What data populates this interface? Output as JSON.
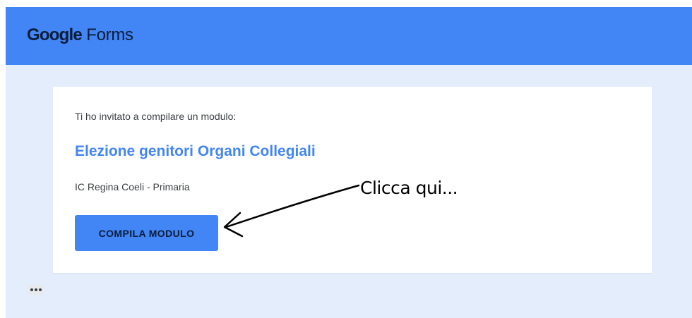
{
  "header": {
    "logo_brand": "Google",
    "logo_product": "Forms",
    "background_color": "#4285f4"
  },
  "card": {
    "invite_text": "Ti ho invitato a compilare un modulo:",
    "form_title": "Elezione genitori Organi Collegiali",
    "organization": "IC Regina Coeli - Primaria",
    "fill_button_label": "COMPILA MODULO",
    "accent_color": "#4285f4"
  },
  "footer": {
    "more_icon": "more-horizontal-icon"
  },
  "annotation": {
    "text": "Clicca qui...",
    "arrow_icon": "arrow-left-icon"
  }
}
